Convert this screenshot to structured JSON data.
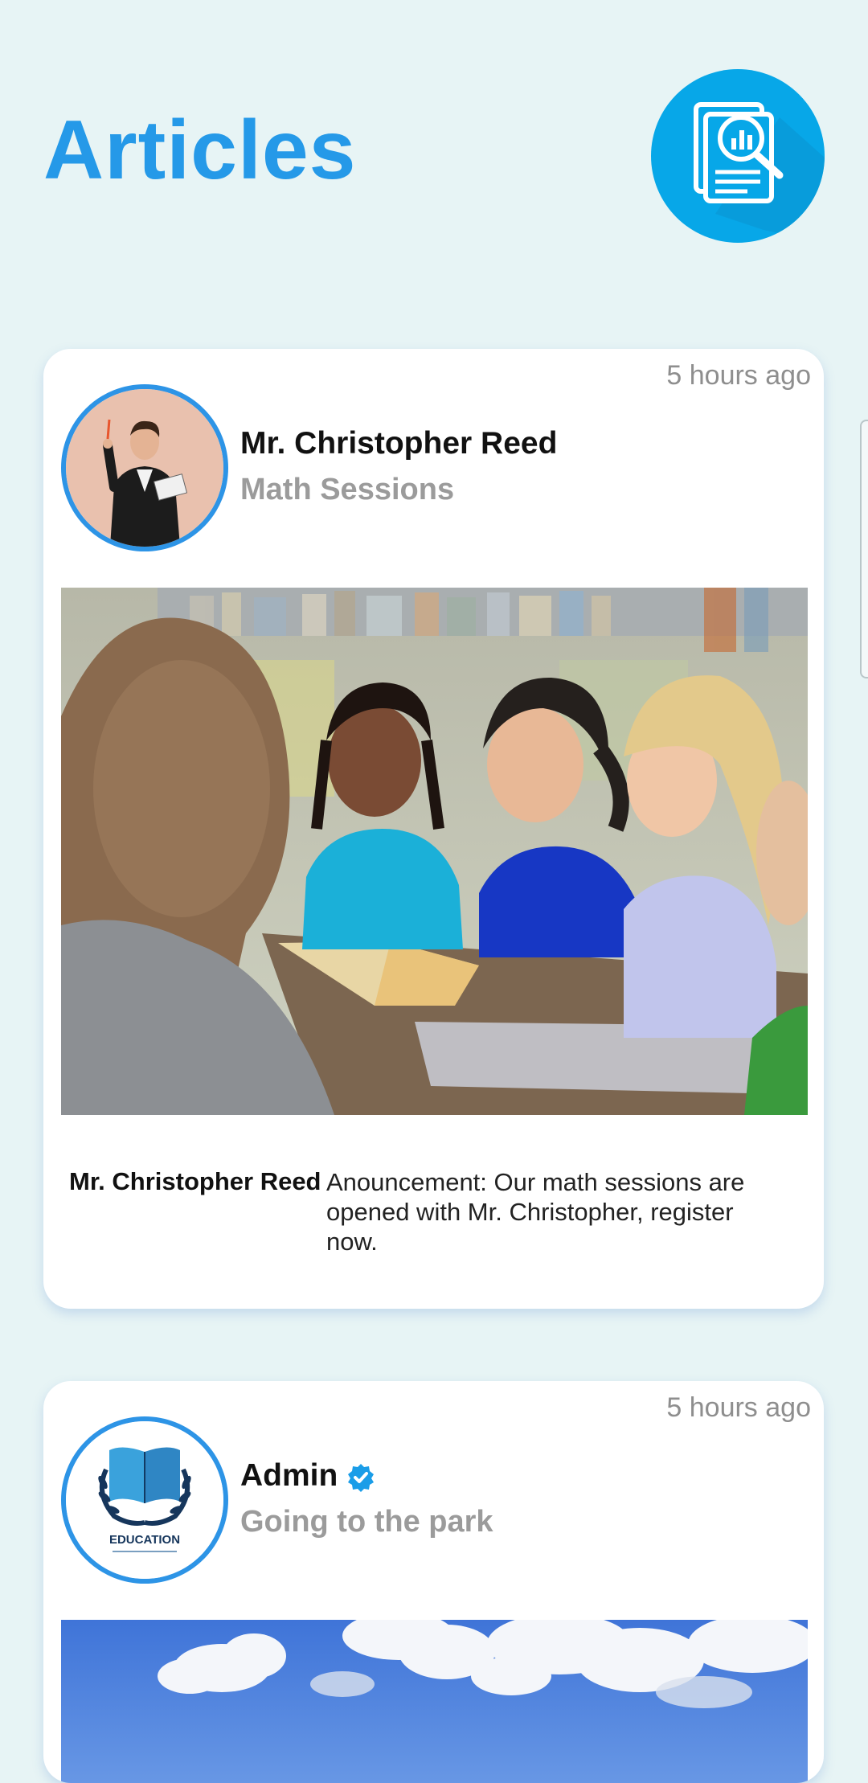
{
  "header": {
    "title": "Articles",
    "icon": "document-search-chart-icon"
  },
  "colors": {
    "accent": "#2599e8",
    "background": "#e7f4f5",
    "icon_circle": "#07a7e8"
  },
  "articles": [
    {
      "timestamp": "5 hours ago",
      "author": "Mr. Christopher Reed",
      "subtitle": "Math Sessions",
      "avatar": "teacher-photo",
      "image": "children-reading-in-library-photo",
      "caption_author": "Mr. Christopher Reed",
      "caption_text": "Anouncement: Our math sessions are opened with Mr. Christopher, register now."
    },
    {
      "timestamp": "5 hours ago",
      "author": "Admin",
      "verified": true,
      "verified_icon": "verified-check-icon",
      "subtitle": "Going to the park",
      "avatar": "education-logo",
      "logo_text": "EDUCATION",
      "image": "blue-sky-clouds-photo"
    }
  ]
}
